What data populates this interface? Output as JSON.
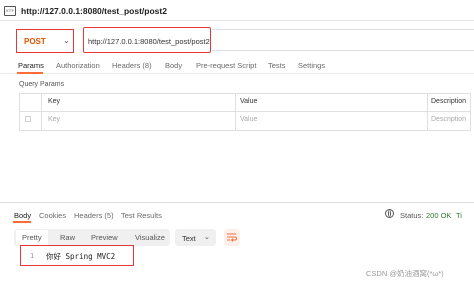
{
  "header": {
    "http_badge": "HTTP",
    "title": "http://127.0.0.1:8080/test_post/post2"
  },
  "request": {
    "method": "POST",
    "url": "http://127.0.0.1:8080/test_post/post2",
    "tabs": [
      "Params",
      "Authorization",
      "Headers (8)",
      "Body",
      "Pre-request Script",
      "Tests",
      "Settings"
    ],
    "active_tab": "Params"
  },
  "query_params": {
    "label": "Query Params",
    "columns": [
      "Key",
      "Value",
      "Description"
    ],
    "placeholders": {
      "key": "Key",
      "value": "Value",
      "description": "Description"
    }
  },
  "response": {
    "tabs": [
      "Body",
      "Cookies",
      "Headers (5)",
      "Test Results"
    ],
    "active_tab": "Body",
    "status_label": "Status:",
    "status_value": "200 OK",
    "size_value": "Ti",
    "view_modes": [
      "Pretty",
      "Raw",
      "Preview",
      "Visualize"
    ],
    "active_view": "Pretty",
    "format": "Text",
    "lines": [
      {
        "no": "1",
        "text": "你好 Spring MVC2"
      }
    ]
  },
  "watermark": "CSDN @奶油酒窝(*ω*)"
}
